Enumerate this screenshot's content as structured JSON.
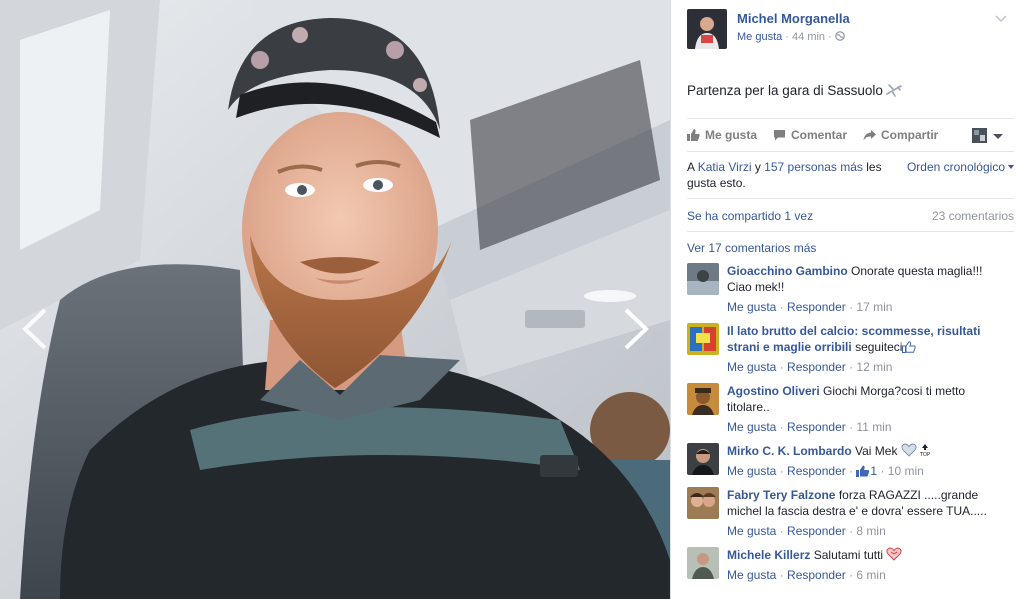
{
  "photo": {
    "prev_label": "Foto anterior",
    "next_label": "Foto siguiente"
  },
  "post": {
    "author": "Michel Morganella",
    "meta_like": "Me gusta",
    "meta_sep": " · ",
    "time": "44 min",
    "meta_sep2": " · ",
    "text": "Partenza per la gara di Sassuolo"
  },
  "actions": {
    "like": "Me gusta",
    "comment": "Comentar",
    "share": "Compartir"
  },
  "social": {
    "likes_prefix": "A ",
    "likes_name": "Katia Virzi",
    "likes_mid": " y ",
    "likes_others": "157 personas más",
    "likes_suffix": " les gusta esto.",
    "sort": "Orden cronológico",
    "shared": "Se ha compartido 1 vez",
    "comment_count": "23 comentarios",
    "more_comments": "Ver 17 comentarios más"
  },
  "comments": [
    {
      "name": "Gioacchino Gambino",
      "text": "Onorate questa maglia!!! Ciao mek!!",
      "like": "Me gusta",
      "reply": "Responder",
      "time": "17 min",
      "avatar_color": "#6e7a86"
    },
    {
      "name": "Il lato brutto del calcio: scommesse, risultati strani e maglie orribili",
      "text": "seguiteci",
      "like": "Me gusta",
      "reply": "Responder",
      "time": "12 min",
      "avatar_color": "#c8b21e"
    },
    {
      "name": "Agostino Oliveri",
      "text": "Giochi Morga?cosi ti metto titolare..",
      "like": "Me gusta",
      "reply": "Responder",
      "time": "11 min",
      "avatar_color": "#8a5a2e"
    },
    {
      "name": "Mirko C. K. Lombardo",
      "text": "Vai Mek",
      "like": "Me gusta",
      "reply": "Responder",
      "likes": "1",
      "time": "10 min",
      "avatar_color": "#3c3f44"
    },
    {
      "name": "Fabry Tery Falzone",
      "text": "forza RAGAZZI .....grande michel la fascia destra e' e dovra' essere TUA.....",
      "like": "Me gusta",
      "reply": "Responder",
      "time": "8 min",
      "avatar_color": "#9c7b55"
    },
    {
      "name": "Michele Killerz",
      "text": "Salutami tutti",
      "like": "Me gusta",
      "reply": "Responder",
      "time": "6 min",
      "avatar_color": "#4f5a52"
    }
  ],
  "meta_sep": " · ",
  "colors": {
    "link": "#365899",
    "muted": "#90949c",
    "text": "#1d2129",
    "divider": "#e5e5e5"
  }
}
